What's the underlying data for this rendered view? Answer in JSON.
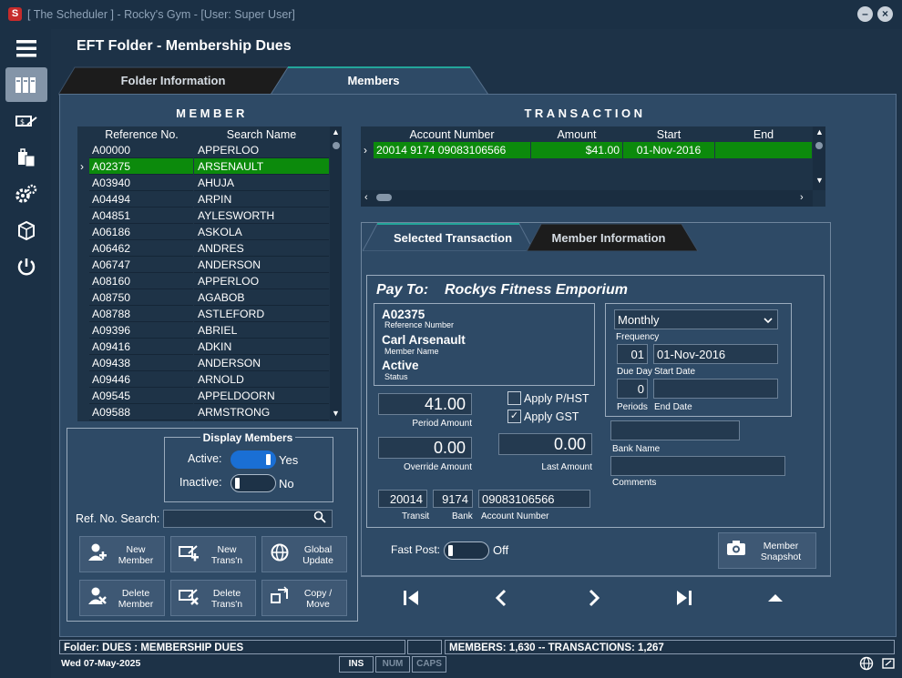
{
  "window": {
    "title": "[ The Scheduler ] - Rocky's Gym - [User: Super User]"
  },
  "page_title": "EFT Folder - Membership Dues",
  "tabs": {
    "folder_info": "Folder Information",
    "members": "Members"
  },
  "member_section": {
    "header": "MEMBER",
    "columns": [
      "Reference No.",
      "Search Name"
    ],
    "rows": [
      [
        "A00000",
        "APPERLOO"
      ],
      [
        "A02375",
        "ARSENAULT"
      ],
      [
        "A03940",
        "AHUJA"
      ],
      [
        "A04494",
        "ARPIN"
      ],
      [
        "A04851",
        "AYLESWORTH"
      ],
      [
        "A06186",
        "ASKOLA"
      ],
      [
        "A06462",
        "ANDRES"
      ],
      [
        "A06747",
        "ANDERSON"
      ],
      [
        "A08160",
        "APPERLOO"
      ],
      [
        "A08750",
        "AGABOB"
      ],
      [
        "A08788",
        "ASTLEFORD"
      ],
      [
        "A09396",
        "ABRIEL"
      ],
      [
        "A09416",
        "ADKIN"
      ],
      [
        "A09438",
        "ANDERSON"
      ],
      [
        "A09446",
        "ARNOLD"
      ],
      [
        "A09545",
        "APPELDOORN"
      ],
      [
        "A09588",
        "ARMSTRONG"
      ]
    ],
    "selected_index": 1
  },
  "display_members": {
    "title": "Display Members",
    "active_label": "Active:",
    "active_value": "Yes",
    "inactive_label": "Inactive:",
    "inactive_value": "No"
  },
  "ref_search": {
    "label": "Ref. No. Search:",
    "value": ""
  },
  "actions": {
    "new_member": "New\nMember",
    "new_trans": "New\nTrans'n",
    "global_update": "Global\nUpdate",
    "delete_member": "Delete\nMember",
    "delete_trans": "Delete\nTrans'n",
    "copy_move": "Copy /\nMove"
  },
  "transaction_section": {
    "header": "TRANSACTION",
    "columns": [
      "Account Number",
      "Amount",
      "Start",
      "End"
    ],
    "rows": [
      [
        "20014 9174 09083106566",
        "$41.00",
        "01-Nov-2016",
        ""
      ]
    ]
  },
  "subtabs": {
    "selected_transaction": "Selected Transaction",
    "member_information": "Member Information"
  },
  "detail": {
    "pay_to": "Pay To:",
    "pay_to_name": "Rockys Fitness Emporium",
    "ref_no": "A02375",
    "ref_no_label": "Reference Number",
    "member_name": "Carl Arsenault",
    "member_name_label": "Member Name",
    "status": "Active",
    "status_label": "Status",
    "period_amount": "41.00",
    "period_amount_label": "Period Amount",
    "override_amount": "0.00",
    "override_amount_label": "Override Amount",
    "apply_phst": "Apply P/HST",
    "apply_gst": "Apply GST",
    "last_amount": "0.00",
    "last_amount_label": "Last Amount",
    "transit": "20014",
    "transit_label": "Transit",
    "bank": "9174",
    "bank_label": "Bank",
    "account_number": "09083106566",
    "account_number_label": "Account Number",
    "frequency": "Monthly",
    "frequency_label": "Frequency",
    "due_day": "01",
    "due_day_label": "Due Day",
    "start_date": "01-Nov-2016",
    "start_date_label": "Start Date",
    "periods": "0",
    "periods_label": "Periods",
    "end_date": "",
    "end_date_label": "End Date",
    "bank_name": "",
    "bank_name_label": "Bank Name",
    "comments": "",
    "comments_label": "Comments"
  },
  "fast_post": {
    "label": "Fast Post:",
    "value": "Off"
  },
  "member_snapshot": "Member\nSnapshot",
  "statusbar": {
    "folder": "Folder: DUES      : MEMBERSHIP DUES",
    "counts": "MEMBERS:   1,630 -- TRANSACTIONS:   1,267",
    "date": "Wed  07-May-2025",
    "ins": "INS",
    "num": "NUM",
    "caps": "CAPS"
  },
  "colors": {
    "selection": "#0c8a0c",
    "toggle_on": "#1a6fd4",
    "background": "#1d3247",
    "panel": "#2e4a66"
  }
}
